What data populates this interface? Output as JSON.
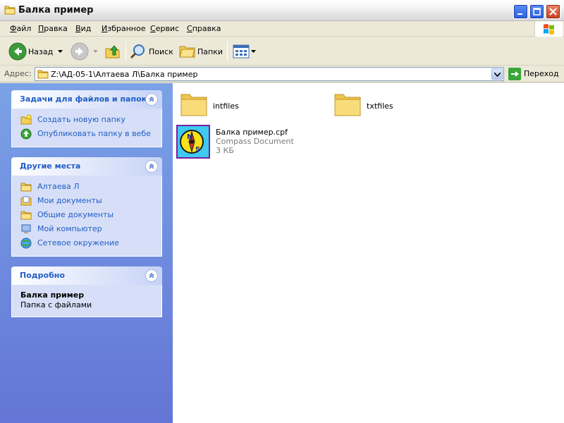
{
  "window": {
    "title": "Балка пример"
  },
  "menu": {
    "items": [
      {
        "label": "Файл",
        "accel": "Ф",
        "rest": "айл"
      },
      {
        "label": "Правка",
        "accel": "П",
        "rest": "равка"
      },
      {
        "label": "Вид",
        "accel": "В",
        "rest": "ид"
      },
      {
        "label": "Избранное",
        "accel": "И",
        "rest": "збранное"
      },
      {
        "label": "Сервис",
        "accel": "С",
        "rest": "ервис"
      },
      {
        "label": "Справка",
        "accel": "С",
        "rest": "правка"
      }
    ]
  },
  "toolbar": {
    "back_label": "Назад",
    "search_label": "Поиск",
    "folders_label": "Папки"
  },
  "address": {
    "label": "Адрес:",
    "value": "Z:\\АД-05-1\\Алтаева Л\\Балка пример",
    "go_label": "Переход"
  },
  "tasks": {
    "title": "Задачи для файлов и папок",
    "items": [
      {
        "label": "Создать новую папку",
        "icon": "new-folder-icon"
      },
      {
        "label": "Опубликовать папку в вебе",
        "icon": "publish-web-icon"
      }
    ]
  },
  "places": {
    "title": "Другие места",
    "items": [
      {
        "label": "Алтаева Л",
        "icon": "folder-icon"
      },
      {
        "label": "Мои документы",
        "icon": "my-documents-icon"
      },
      {
        "label": "Общие документы",
        "icon": "folder-icon"
      },
      {
        "label": "Мой компьютер",
        "icon": "my-computer-icon"
      },
      {
        "label": "Сетевое окружение",
        "icon": "network-icon"
      }
    ]
  },
  "details": {
    "title": "Подробно",
    "name": "Балка пример",
    "type": "Папка с файлами"
  },
  "files": [
    {
      "name": "intfiles",
      "kind": "folder"
    },
    {
      "name": "txtfiles",
      "kind": "folder"
    },
    {
      "name": "Балка пример.cpf",
      "kind": "compass",
      "type": "Compass Document",
      "size": "3 КБ"
    }
  ],
  "colors": {
    "titlebar": "#f3f3f3",
    "task_link": "#215dc6",
    "pane_gradient_top": "#7ba2e7",
    "pane_gradient_bottom": "#6375d6",
    "panel_body": "#d6dff7"
  }
}
